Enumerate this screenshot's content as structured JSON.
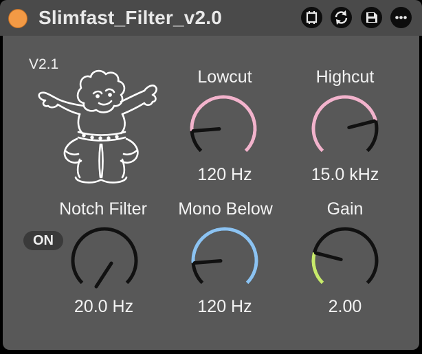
{
  "device": {
    "title": "Slimfast_Filter_v2.0",
    "version": "V2.1",
    "accent_color": "#f39a45",
    "title_buttons": [
      {
        "name": "freeze-icon"
      },
      {
        "name": "refresh-icon"
      },
      {
        "name": "save-icon"
      },
      {
        "name": "more-icon"
      }
    ]
  },
  "knobs": {
    "lowcut": {
      "label": "Lowcut",
      "value": "120 Hz",
      "arc_color": "#f2b3cc",
      "fraction": 0.15
    },
    "highcut": {
      "label": "Highcut",
      "value": "15.0 kHz",
      "arc_color": "#f2b3cc",
      "fraction": 0.78
    },
    "notch": {
      "label": "Notch Filter",
      "value": "20.0 Hz",
      "arc_color": "#f2b3cc",
      "fraction": 0.0,
      "toggle": "ON"
    },
    "mono": {
      "label": "Mono Below",
      "value": "120 Hz",
      "arc_color": "#8cc3f2",
      "fraction": 0.15
    },
    "gain": {
      "label": "Gain",
      "value": "2.00",
      "arc_color": "#c7ea6b",
      "fraction": 0.22
    }
  }
}
